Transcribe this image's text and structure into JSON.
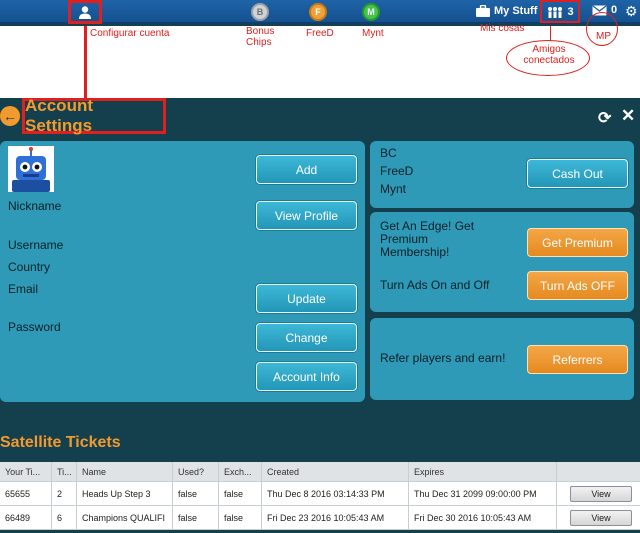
{
  "topbar": {
    "coins": [
      {
        "name": "bonus",
        "glyph": "B",
        "color": "#cfd3d6"
      },
      {
        "name": "freed",
        "glyph": "F",
        "color": "#f0a038"
      },
      {
        "name": "mynt",
        "glyph": "M",
        "color": "#43c64a"
      }
    ],
    "mystuff_label": "My Stuff",
    "friends_count": "3",
    "mail_count": "0",
    "icons": [
      "user-icon",
      "briefcase-icon",
      "friends-icon",
      "mail-icon",
      "gear-icon"
    ]
  },
  "annotations": {
    "configurar": "Configurar cuenta",
    "bonus": "Bonus Chips",
    "freed": "FreeD",
    "mynt": "Mynt",
    "mis_cosas": "Mis cosas",
    "amigos": "Amigos conectados",
    "mp": "MP"
  },
  "header": {
    "title": "Account Settings"
  },
  "account": {
    "nickname_label": "Nickname",
    "username_label": "Username",
    "country_label": "Country",
    "email_label": "Email",
    "password_label": "Password",
    "add_label": "Add",
    "view_profile_label": "View Profile",
    "update_label": "Update",
    "change_label": "Change",
    "account_info_label": "Account Info"
  },
  "balances": {
    "bc_label": "BC",
    "freed_label": "FreeD",
    "mynt_label": "Mynt",
    "cash_out_label": "Cash Out"
  },
  "premium": {
    "edge_text": "Get An Edge! Get Premium Membership!",
    "get_premium_label": "Get Premium",
    "ads_text": "Turn Ads On and Off",
    "ads_button_label": "Turn Ads OFF"
  },
  "referral": {
    "text": "Refer players and earn!",
    "button_label": "Referrers"
  },
  "satellite": {
    "title": "Satellite Tickets",
    "columns": [
      "Your Ti...",
      "Ti...",
      "Name",
      "Used?",
      "Exch...",
      "Created",
      "Expires",
      ""
    ],
    "rows": [
      [
        "65655",
        "2",
        "Heads Up Step 3",
        "false",
        "false",
        "Thu Dec 8 2016 03:14:33 PM",
        "Thu Dec 31 2099 09:00:00 PM",
        "View"
      ],
      [
        "66489",
        "6",
        "Champions QUALIFI",
        "false",
        "false",
        "Fri Dec 23 2016 10:05:43 AM",
        "Fri Dec 30 2016 10:05:43 AM",
        "View"
      ]
    ]
  },
  "colors": {
    "accent_orange": "#f29a2e",
    "panel_blue": "#2e9ab8",
    "annotation_red": "#e0201e"
  }
}
